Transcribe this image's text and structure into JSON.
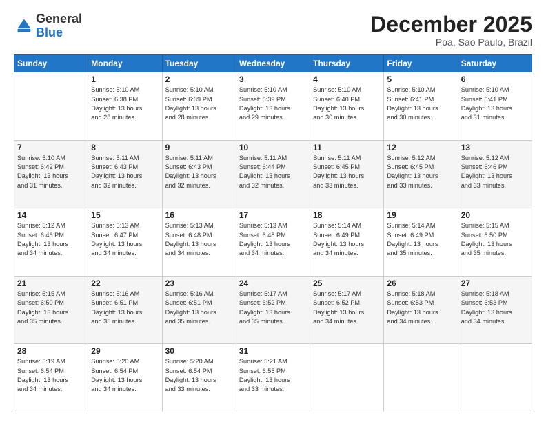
{
  "logo": {
    "general": "General",
    "blue": "Blue"
  },
  "header": {
    "month": "December 2025",
    "location": "Poa, Sao Paulo, Brazil"
  },
  "days": [
    "Sunday",
    "Monday",
    "Tuesday",
    "Wednesday",
    "Thursday",
    "Friday",
    "Saturday"
  ],
  "weeks": [
    [
      {
        "day": "",
        "info": ""
      },
      {
        "day": "1",
        "info": "Sunrise: 5:10 AM\nSunset: 6:38 PM\nDaylight: 13 hours\nand 28 minutes."
      },
      {
        "day": "2",
        "info": "Sunrise: 5:10 AM\nSunset: 6:39 PM\nDaylight: 13 hours\nand 28 minutes."
      },
      {
        "day": "3",
        "info": "Sunrise: 5:10 AM\nSunset: 6:39 PM\nDaylight: 13 hours\nand 29 minutes."
      },
      {
        "day": "4",
        "info": "Sunrise: 5:10 AM\nSunset: 6:40 PM\nDaylight: 13 hours\nand 30 minutes."
      },
      {
        "day": "5",
        "info": "Sunrise: 5:10 AM\nSunset: 6:41 PM\nDaylight: 13 hours\nand 30 minutes."
      },
      {
        "day": "6",
        "info": "Sunrise: 5:10 AM\nSunset: 6:41 PM\nDaylight: 13 hours\nand 31 minutes."
      }
    ],
    [
      {
        "day": "7",
        "info": "Sunrise: 5:10 AM\nSunset: 6:42 PM\nDaylight: 13 hours\nand 31 minutes."
      },
      {
        "day": "8",
        "info": "Sunrise: 5:11 AM\nSunset: 6:43 PM\nDaylight: 13 hours\nand 32 minutes."
      },
      {
        "day": "9",
        "info": "Sunrise: 5:11 AM\nSunset: 6:43 PM\nDaylight: 13 hours\nand 32 minutes."
      },
      {
        "day": "10",
        "info": "Sunrise: 5:11 AM\nSunset: 6:44 PM\nDaylight: 13 hours\nand 32 minutes."
      },
      {
        "day": "11",
        "info": "Sunrise: 5:11 AM\nSunset: 6:45 PM\nDaylight: 13 hours\nand 33 minutes."
      },
      {
        "day": "12",
        "info": "Sunrise: 5:12 AM\nSunset: 6:45 PM\nDaylight: 13 hours\nand 33 minutes."
      },
      {
        "day": "13",
        "info": "Sunrise: 5:12 AM\nSunset: 6:46 PM\nDaylight: 13 hours\nand 33 minutes."
      }
    ],
    [
      {
        "day": "14",
        "info": "Sunrise: 5:12 AM\nSunset: 6:46 PM\nDaylight: 13 hours\nand 34 minutes."
      },
      {
        "day": "15",
        "info": "Sunrise: 5:13 AM\nSunset: 6:47 PM\nDaylight: 13 hours\nand 34 minutes."
      },
      {
        "day": "16",
        "info": "Sunrise: 5:13 AM\nSunset: 6:48 PM\nDaylight: 13 hours\nand 34 minutes."
      },
      {
        "day": "17",
        "info": "Sunrise: 5:13 AM\nSunset: 6:48 PM\nDaylight: 13 hours\nand 34 minutes."
      },
      {
        "day": "18",
        "info": "Sunrise: 5:14 AM\nSunset: 6:49 PM\nDaylight: 13 hours\nand 34 minutes."
      },
      {
        "day": "19",
        "info": "Sunrise: 5:14 AM\nSunset: 6:49 PM\nDaylight: 13 hours\nand 35 minutes."
      },
      {
        "day": "20",
        "info": "Sunrise: 5:15 AM\nSunset: 6:50 PM\nDaylight: 13 hours\nand 35 minutes."
      }
    ],
    [
      {
        "day": "21",
        "info": "Sunrise: 5:15 AM\nSunset: 6:50 PM\nDaylight: 13 hours\nand 35 minutes."
      },
      {
        "day": "22",
        "info": "Sunrise: 5:16 AM\nSunset: 6:51 PM\nDaylight: 13 hours\nand 35 minutes."
      },
      {
        "day": "23",
        "info": "Sunrise: 5:16 AM\nSunset: 6:51 PM\nDaylight: 13 hours\nand 35 minutes."
      },
      {
        "day": "24",
        "info": "Sunrise: 5:17 AM\nSunset: 6:52 PM\nDaylight: 13 hours\nand 35 minutes."
      },
      {
        "day": "25",
        "info": "Sunrise: 5:17 AM\nSunset: 6:52 PM\nDaylight: 13 hours\nand 34 minutes."
      },
      {
        "day": "26",
        "info": "Sunrise: 5:18 AM\nSunset: 6:53 PM\nDaylight: 13 hours\nand 34 minutes."
      },
      {
        "day": "27",
        "info": "Sunrise: 5:18 AM\nSunset: 6:53 PM\nDaylight: 13 hours\nand 34 minutes."
      }
    ],
    [
      {
        "day": "28",
        "info": "Sunrise: 5:19 AM\nSunset: 6:54 PM\nDaylight: 13 hours\nand 34 minutes."
      },
      {
        "day": "29",
        "info": "Sunrise: 5:20 AM\nSunset: 6:54 PM\nDaylight: 13 hours\nand 34 minutes."
      },
      {
        "day": "30",
        "info": "Sunrise: 5:20 AM\nSunset: 6:54 PM\nDaylight: 13 hours\nand 33 minutes."
      },
      {
        "day": "31",
        "info": "Sunrise: 5:21 AM\nSunset: 6:55 PM\nDaylight: 13 hours\nand 33 minutes."
      },
      {
        "day": "",
        "info": ""
      },
      {
        "day": "",
        "info": ""
      },
      {
        "day": "",
        "info": ""
      }
    ]
  ]
}
